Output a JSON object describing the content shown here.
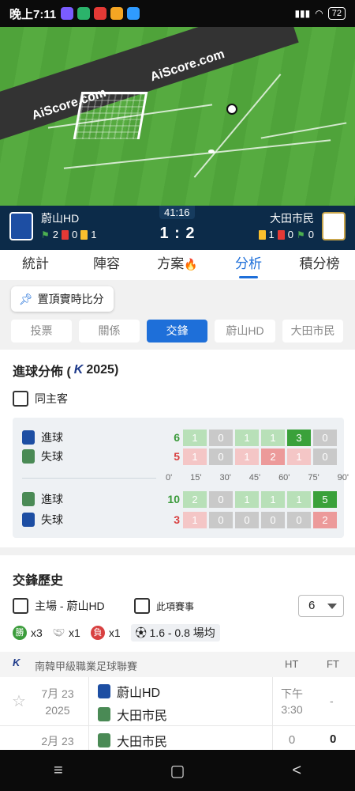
{
  "status_bar": {
    "time": "晚上7:11",
    "battery": "72"
  },
  "field": {
    "watermark_1": "AiScore.com",
    "watermark_2": "AiScore.com"
  },
  "match": {
    "clock": "41:16",
    "home": {
      "name": "蔚山HD",
      "corners": "2",
      "red": "0",
      "yellow": "1"
    },
    "away": {
      "name": "大田市民",
      "yellow": "1",
      "red": "0",
      "corners": "0"
    },
    "score": "1 : 2"
  },
  "main_tabs": [
    "統計",
    "陣容",
    "方案",
    "分析",
    "積分榜"
  ],
  "pin_button": "置頂實時比分",
  "sub_tabs": [
    "投票",
    "關係",
    "交鋒",
    "蔚山HD",
    "大田市民"
  ],
  "goal_distribution": {
    "title": "進球分佈 (",
    "league_mark": "K",
    "year": "2025)",
    "same_home_away": "同主客",
    "time_axis": [
      "0'",
      "15'",
      "30'",
      "45'",
      "60'",
      "75'",
      "90'"
    ],
    "rows": [
      {
        "label": "進球",
        "total": "6",
        "values": [
          "1",
          "0",
          "1",
          "1",
          "3",
          "0"
        ]
      },
      {
        "label": "失球",
        "total": "5",
        "values": [
          "1",
          "0",
          "1",
          "2",
          "1",
          "0"
        ]
      },
      {
        "label": "進球",
        "total": "10",
        "values": [
          "2",
          "0",
          "1",
          "1",
          "1",
          "5"
        ]
      },
      {
        "label": "失球",
        "total": "3",
        "values": [
          "1",
          "0",
          "0",
          "0",
          "0",
          "2"
        ]
      }
    ]
  },
  "h2h": {
    "title": "交鋒歷史",
    "filter_home": "主場 - 蔚山HD",
    "filter_comp": "此項賽事",
    "count_select": "6",
    "win_label": "勝",
    "wins": "x3",
    "draws": "x1",
    "loss_label": "負",
    "losses": "x1",
    "avg": "1.6 - 0.8 場均",
    "league": {
      "mark": "K",
      "name": "南韓甲級職業足球聯賽",
      "ht": "HT",
      "ft": "FT"
    },
    "matches": [
      {
        "date_1": "7月 23",
        "date_2": "2025",
        "home": "蔚山HD",
        "away": "大田市民",
        "time_1": "下午",
        "time_2": "3:30",
        "ft": "-"
      },
      {
        "date_1": "2月 23",
        "home": "大田市民",
        "ht": "0",
        "ft": "0"
      }
    ]
  },
  "nav": {
    "menu": "≡",
    "home": "▢",
    "back": "<"
  }
}
